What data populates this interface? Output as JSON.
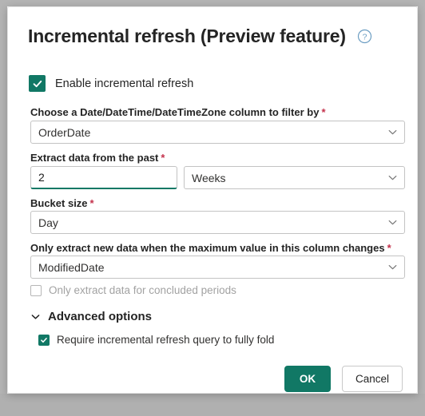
{
  "dialog": {
    "title": "Incremental refresh (Preview feature)",
    "help_icon": "help-circle-icon",
    "accent_color": "#117865",
    "required_marker": "*",
    "required_marker_color": "#c4314b"
  },
  "enable": {
    "label": "Enable incremental refresh",
    "checked": true
  },
  "fields": {
    "date_column": {
      "label": "Choose a Date/DateTime/DateTimeZone column to filter by",
      "required": true,
      "value": "OrderDate",
      "chevron_icon": "chevron-down-icon"
    },
    "extract_past": {
      "label": "Extract data from the past",
      "required": true,
      "amount_value": "2",
      "unit_value": "Weeks",
      "chevron_icon": "chevron-down-icon"
    },
    "bucket_size": {
      "label": "Bucket size",
      "required": true,
      "value": "Day",
      "chevron_icon": "chevron-down-icon"
    },
    "detect_column": {
      "label": "Only extract new data when the maximum value in this column changes",
      "required": true,
      "value": "ModifiedDate",
      "chevron_icon": "chevron-down-icon"
    }
  },
  "options": {
    "concluded_periods": {
      "label": "Only extract data for concluded periods",
      "checked": false,
      "disabled": true
    },
    "advanced": {
      "label": "Advanced options",
      "expanded": true,
      "chevron_icon": "chevron-down-icon"
    },
    "fully_fold": {
      "label": "Require incremental refresh query to fully fold",
      "checked": true,
      "disabled": false
    }
  },
  "footer": {
    "ok_label": "OK",
    "cancel_label": "Cancel"
  }
}
